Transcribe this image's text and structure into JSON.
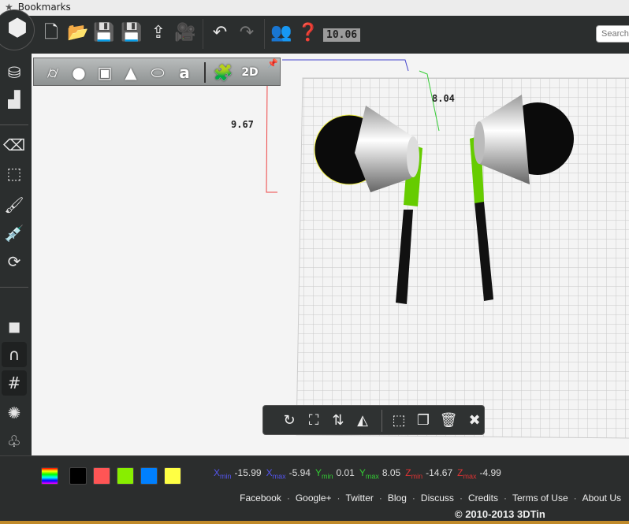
{
  "bookmarks_bar": {
    "label": "Bookmarks"
  },
  "toolbar": {
    "dimension_x": "10.06",
    "search_placeholder": "Search"
  },
  "viewport": {
    "dimension_y": "8.04",
    "dimension_z": "9.67",
    "primitive_2d_label": "2D"
  },
  "footer": {
    "swatches": [
      "#000000",
      "#ff5555",
      "#88ee00",
      "#0080ff",
      "#ffff44"
    ],
    "bounds": [
      {
        "axis": "X",
        "sub": "min",
        "value": "-15.99",
        "color": "#5555ee"
      },
      {
        "axis": "X",
        "sub": "max",
        "value": "-5.94",
        "color": "#5555ee"
      },
      {
        "axis": "Y",
        "sub": "min",
        "value": "0.01",
        "color": "#33cc33"
      },
      {
        "axis": "Y",
        "sub": "max",
        "value": "8.05",
        "color": "#33cc33"
      },
      {
        "axis": "Z",
        "sub": "min",
        "value": "-14.67",
        "color": "#dd3333"
      },
      {
        "axis": "Z",
        "sub": "max",
        "value": "-4.99",
        "color": "#dd3333"
      }
    ],
    "links": [
      "Facebook",
      "Google+",
      "Twitter",
      "Blog",
      "Discuss",
      "Credits",
      "Terms of Use",
      "About Us"
    ],
    "copyright": "© 2010-2013 3DTin"
  }
}
